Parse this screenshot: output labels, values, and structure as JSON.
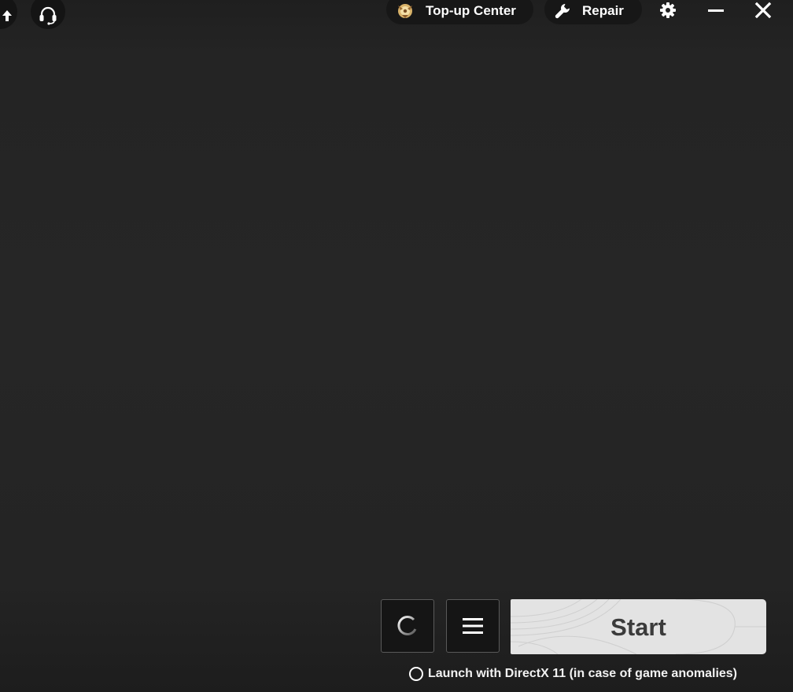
{
  "topbar": {
    "back_icon": "arrow-up-icon",
    "support_icon": "headset-icon",
    "topup_label": "Top-up Center",
    "topup_icon": "coin-emblem-icon",
    "repair_label": "Repair",
    "repair_icon": "wrench-icon",
    "settings_icon": "gear-icon",
    "minimize_icon": "minimize-icon",
    "close_icon": "close-icon"
  },
  "launcher": {
    "refresh_icon": "refresh-spinner-icon",
    "menu_icon": "hamburger-icon",
    "start_label": "Start",
    "directx_option_label": "Launch with DirectX 11 (in case of game anomalies)",
    "directx_checked": false
  },
  "colors": {
    "background": "#262626",
    "start_button": "#e3e3e3",
    "start_text": "#3b3b3b",
    "pill_background": "#171717"
  }
}
